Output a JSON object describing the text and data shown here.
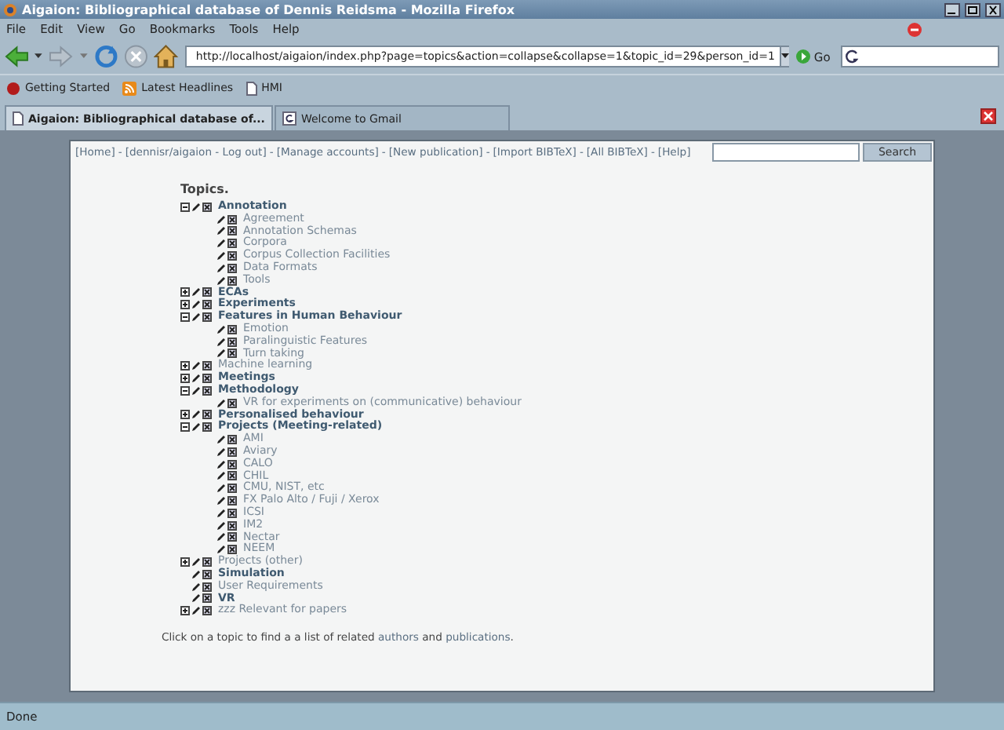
{
  "window": {
    "title": "Aigaion: Bibliographical database of Dennis Reidsma - Mozilla Firefox"
  },
  "menu": [
    "File",
    "Edit",
    "View",
    "Go",
    "Bookmarks",
    "Tools",
    "Help"
  ],
  "address": {
    "value": "http://localhost/aigaion/index.php?page=topics&action=collapse&collapse=1&topic_id=29&person_id=1"
  },
  "go_label": "Go",
  "bookmarks": [
    {
      "kind": "start",
      "label": "Getting Started"
    },
    {
      "kind": "feed",
      "label": "Latest Headlines"
    },
    {
      "kind": "page",
      "label": "HMI"
    }
  ],
  "tabs": [
    {
      "label": "Aigaion: Bibliographical database of...",
      "selected": true,
      "kind": "page"
    },
    {
      "label": "Welcome to Gmail",
      "selected": false,
      "kind": "google"
    }
  ],
  "nav": {
    "separator": "-",
    "links": [
      "[Home]",
      "[dennisr/aigaion - Log out]",
      "[Manage accounts]",
      "[New publication]",
      "[Import BIBTeX]",
      "[All BIBTeX]",
      "[Help]"
    ],
    "search_button": "Search"
  },
  "heading": "Topics.",
  "topics": [
    {
      "label": "Annotation",
      "bold": true,
      "expanded": true,
      "children": [
        {
          "label": "Agreement"
        },
        {
          "label": "Annotation Schemas"
        },
        {
          "label": "Corpora"
        },
        {
          "label": "Corpus Collection Facilities"
        },
        {
          "label": "Data Formats"
        },
        {
          "label": "Tools"
        }
      ]
    },
    {
      "label": "ECAs",
      "bold": true,
      "expanded": false
    },
    {
      "label": "Experiments",
      "bold": true,
      "expanded": false
    },
    {
      "label": "Features in Human Behaviour",
      "bold": true,
      "expanded": true,
      "children": [
        {
          "label": "Emotion"
        },
        {
          "label": "Paralinguistic Features"
        },
        {
          "label": "Turn taking"
        }
      ]
    },
    {
      "label": "Machine learning",
      "bold": false,
      "expanded": false
    },
    {
      "label": "Meetings",
      "bold": true,
      "expanded": false
    },
    {
      "label": "Methodology",
      "bold": true,
      "expanded": true,
      "children": [
        {
          "label": "VR for experiments on (communicative) behaviour"
        }
      ]
    },
    {
      "label": "Personalised behaviour",
      "bold": true,
      "expanded": false
    },
    {
      "label": "Projects (Meeting-related)",
      "bold": true,
      "expanded": true,
      "children": [
        {
          "label": "AMI"
        },
        {
          "label": "Aviary"
        },
        {
          "label": "CALO"
        },
        {
          "label": "CHIL"
        },
        {
          "label": "CMU, NIST, etc"
        },
        {
          "label": "FX Palo Alto / Fuji / Xerox"
        },
        {
          "label": "ICSI"
        },
        {
          "label": "IM2"
        },
        {
          "label": "Nectar"
        },
        {
          "label": "NEEM"
        }
      ]
    },
    {
      "label": "Projects (other)",
      "bold": false,
      "expanded": false
    },
    {
      "label": "Simulation",
      "bold": true
    },
    {
      "label": "User Requirements",
      "bold": false
    },
    {
      "label": "VR",
      "bold": true
    },
    {
      "label": "zzz Relevant for papers",
      "bold": false,
      "expanded": false
    }
  ],
  "footer": [
    {
      "text": "Click on a topic to find a a list of related",
      "link": false
    },
    {
      "text": "authors",
      "link": true
    },
    {
      "text": "and",
      "link": false
    },
    {
      "text": "publications",
      "link": true
    },
    {
      "text": ".",
      "link": false
    }
  ],
  "status_bar": "Done"
}
